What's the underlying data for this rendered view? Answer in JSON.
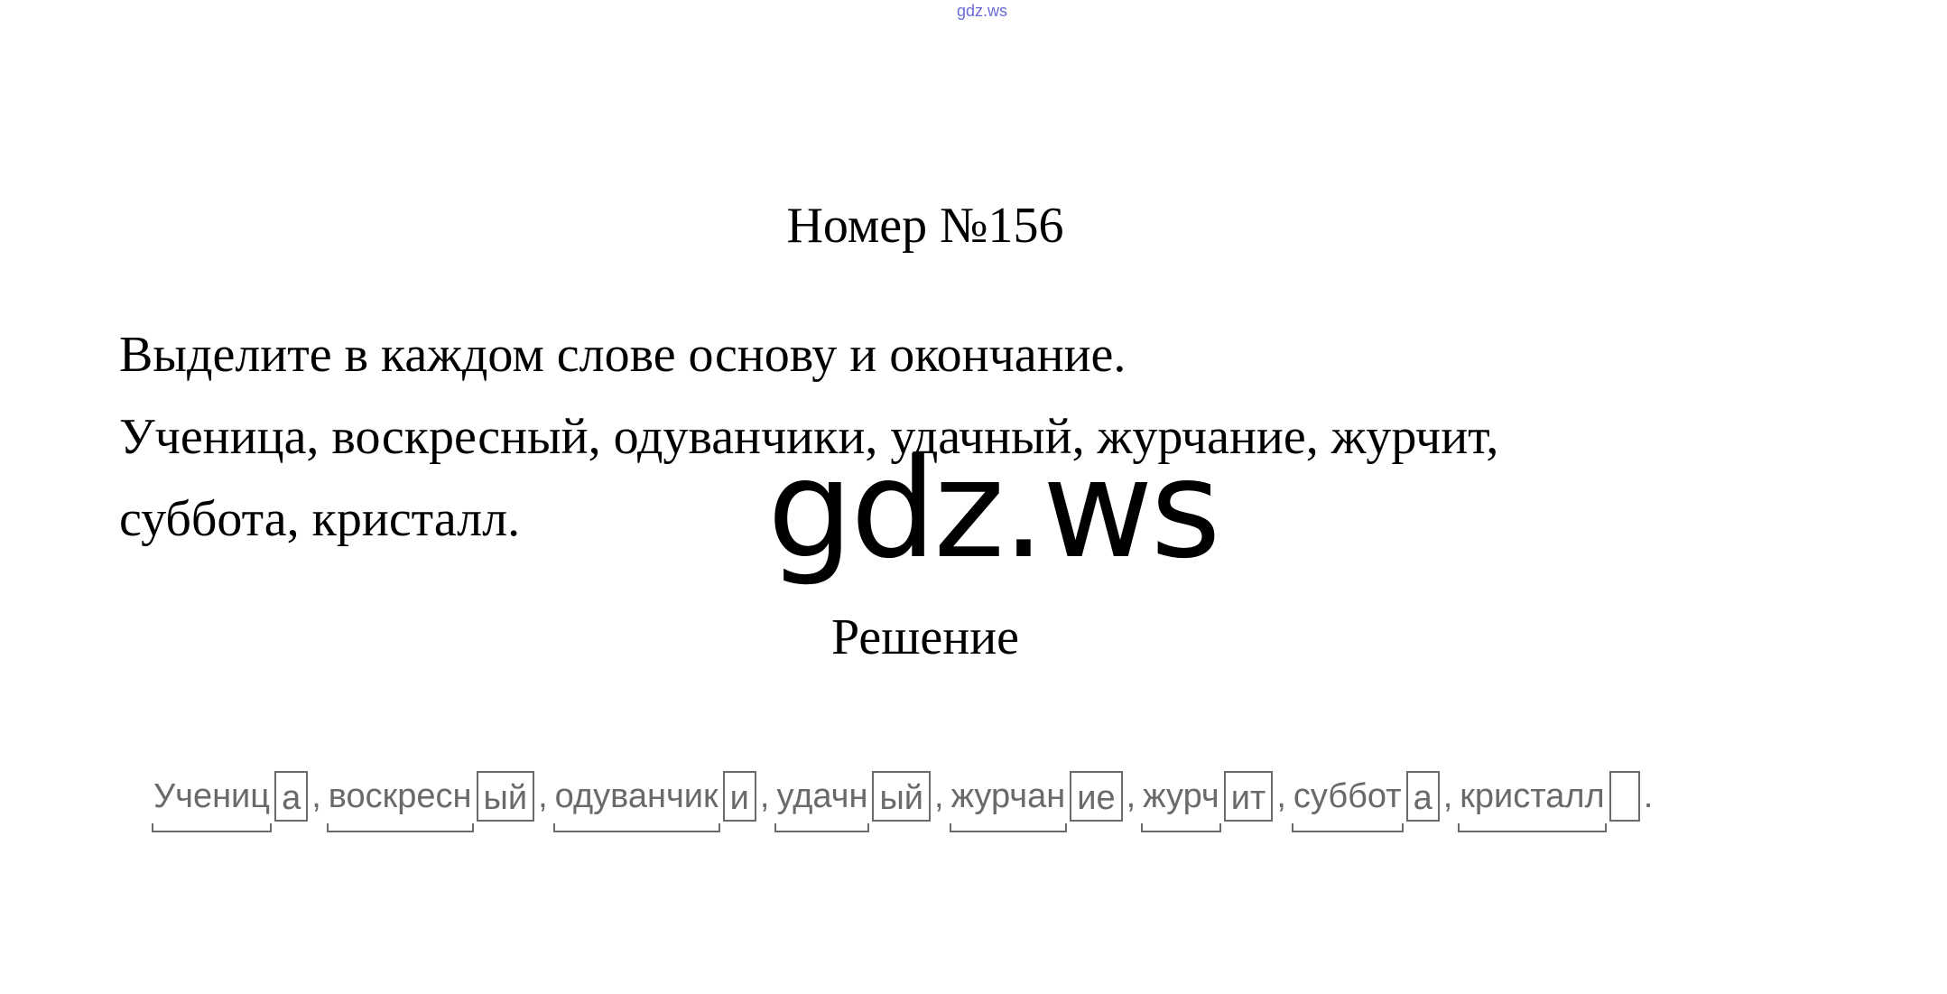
{
  "site_label": "gdz.ws",
  "title": "Номер №156",
  "task": {
    "line1": "Выделите в каждом слове основу и окончание.",
    "line2": "Ученица, воскресный, одуванчики, удачный, журчание, журчит,",
    "line3": "суббота, кристалл."
  },
  "watermark": "gdz.ws",
  "solution_heading": "Решение",
  "answer": {
    "words": [
      {
        "stem": "Учениц",
        "ending": "а"
      },
      {
        "stem": "воскресн",
        "ending": "ый"
      },
      {
        "stem": "одуванчик",
        "ending": "и"
      },
      {
        "stem": "удачн",
        "ending": "ый"
      },
      {
        "stem": "журчан",
        "ending": "ие"
      },
      {
        "stem": "журч",
        "ending": "ит"
      },
      {
        "stem": "суббот",
        "ending": "а"
      },
      {
        "stem": "кристалл",
        "ending": ""
      }
    ],
    "separator": ",",
    "terminator": "."
  }
}
